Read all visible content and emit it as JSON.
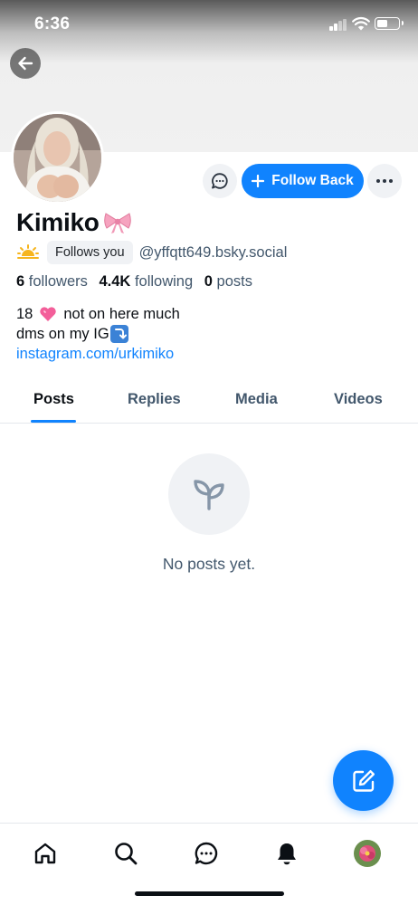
{
  "status_bar": {
    "time": "6:36"
  },
  "profile": {
    "display_name": "Kimiko",
    "follows_you_label": "Follows you",
    "handle": "@yffqtt649.bsky.social",
    "stats": {
      "followers_count": "6",
      "followers_label": "followers",
      "following_count": "4.4K",
      "following_label": "following",
      "posts_count": "0",
      "posts_label": "posts"
    },
    "bio": {
      "line1_prefix": "18",
      "line1_suffix": "not on here much",
      "line2": "dms on my IG",
      "link": "instagram.com/urkimiko"
    }
  },
  "actions": {
    "follow_label": "Follow Back"
  },
  "tabs": [
    {
      "label": "Posts",
      "active": true
    },
    {
      "label": "Replies",
      "active": false
    },
    {
      "label": "Media",
      "active": false
    },
    {
      "label": "Videos",
      "active": false
    }
  ],
  "empty_state": {
    "text": "No posts yet."
  },
  "colors": {
    "accent": "#1083fe",
    "muted_text": "#42576c",
    "surface": "#f0f2f5"
  }
}
